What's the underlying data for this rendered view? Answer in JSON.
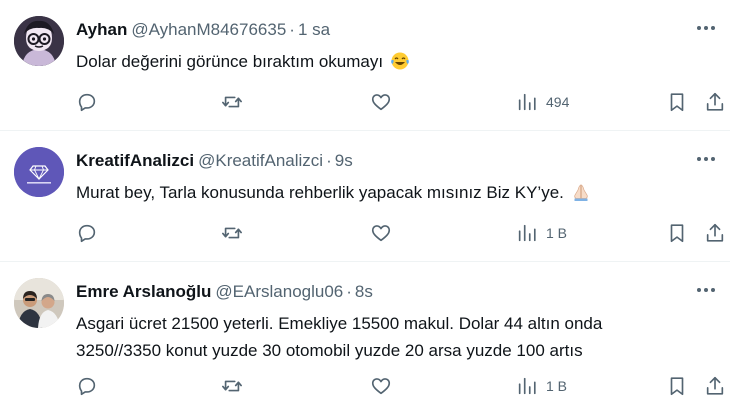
{
  "tweets": [
    {
      "name": "Ayhan",
      "handle": "@AyhanM84676635",
      "separator": "·",
      "time": "1 sa",
      "text": "Dolar değerini görünce bıraktım okumayı",
      "emoji": "face-with-tears-of-joy",
      "views": "494"
    },
    {
      "name": "KreatifAnalizci",
      "handle": "@KreatifAnalizci",
      "separator": "·",
      "time": "9s",
      "text": "Murat bey, Tarla konusunda rehberlik yapacak mısınız Biz KY’ye.",
      "emoji": "folded-hands",
      "views": "1 B"
    },
    {
      "name": "Emre Arslanoğlu",
      "handle": "@EArslanoglu06",
      "separator": "·",
      "time": "8s",
      "text_line1": "Asgari ücret 21500 yeterli. Emekliye 15500 makul.  Dolar 44 altın onda",
      "text_line2": "3250//3350 konut yuzde 30 otomobil yuzde 20 arsa yuzde 100 artıs",
      "views": "1 B"
    }
  ],
  "icons": [
    "reply-icon",
    "retweet-icon",
    "like-icon",
    "views-icon",
    "bookmark-icon",
    "share-icon",
    "more-icon"
  ],
  "colors": {
    "text": "#0f1419",
    "secondary": "#536471",
    "divider": "#eff3f4",
    "avatar_purple": "#5f57b8"
  }
}
